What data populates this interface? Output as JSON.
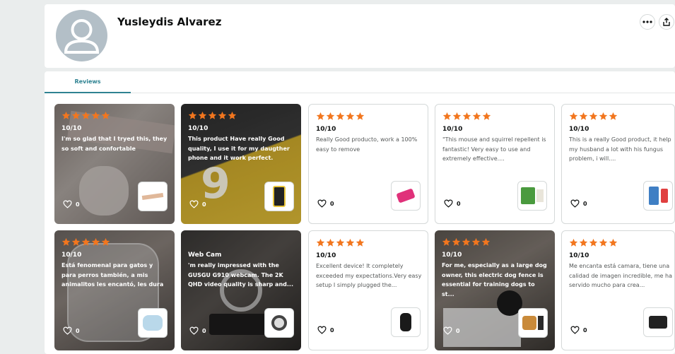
{
  "profile": {
    "name": "Yusleydis Alvarez"
  },
  "tabs": [
    {
      "label": "Reviews"
    }
  ],
  "colors": {
    "star": "#f2761e",
    "tab_active": "#2f8392"
  },
  "reviews": [
    {
      "score": "10/10",
      "text": "I'm so glad that I tryed this, they so soft and confortable",
      "likes": "0",
      "product_icon": "bandage-strips-thumb"
    },
    {
      "score": "10/10",
      "text": "This product Have really Good quality, I use it for my daugther phone and it work perfect.",
      "likes": "0",
      "product_icon": "screen-protector-thumb"
    },
    {
      "score": "10/10",
      "text": "Really Good producto, work a 100% easy to remove",
      "likes": "0",
      "product_icon": "pink-tool-thumb"
    },
    {
      "score": "10/10",
      "text": "\"This mouse and squirrel repellent is fantastic! Very easy to use and extremely effective....",
      "likes": "0",
      "product_icon": "repellent-box-thumb"
    },
    {
      "score": "10/10",
      "text": "This is a really Good product, it help my husband a lot with his fungus problem, i will....",
      "likes": "0",
      "product_icon": "fungus-treatment-thumb"
    },
    {
      "score": "10/10",
      "text": "Está fenomenal para gatos y para perros también, a mis animalitos les encantó, les dura el agua to...",
      "likes": "0",
      "product_icon": "water-fountain-thumb"
    },
    {
      "score": "Web Cam",
      "text": "'m really impressed with the GUSGU G910 webcam. The 2K QHD video quality is sharp and...",
      "likes": "0",
      "product_icon": "webcam-thumb"
    },
    {
      "score": "10/10",
      "text": "Excellent device! It completely exceeded my expectations.Very easy setup I simply plugged the...",
      "likes": "0",
      "product_icon": "black-device-thumb"
    },
    {
      "score": "10/10",
      "text": "For me, especially as a large dog owner, this electric dog fence is essential for training dogs to st...",
      "likes": "0",
      "product_icon": "dog-fence-thumb"
    },
    {
      "score": "10/10",
      "text": "Me encanta está camara, tiene una calidad de imagen incredible, me ha servido mucho para crea...",
      "likes": "0",
      "product_icon": "camera-kit-thumb"
    }
  ]
}
